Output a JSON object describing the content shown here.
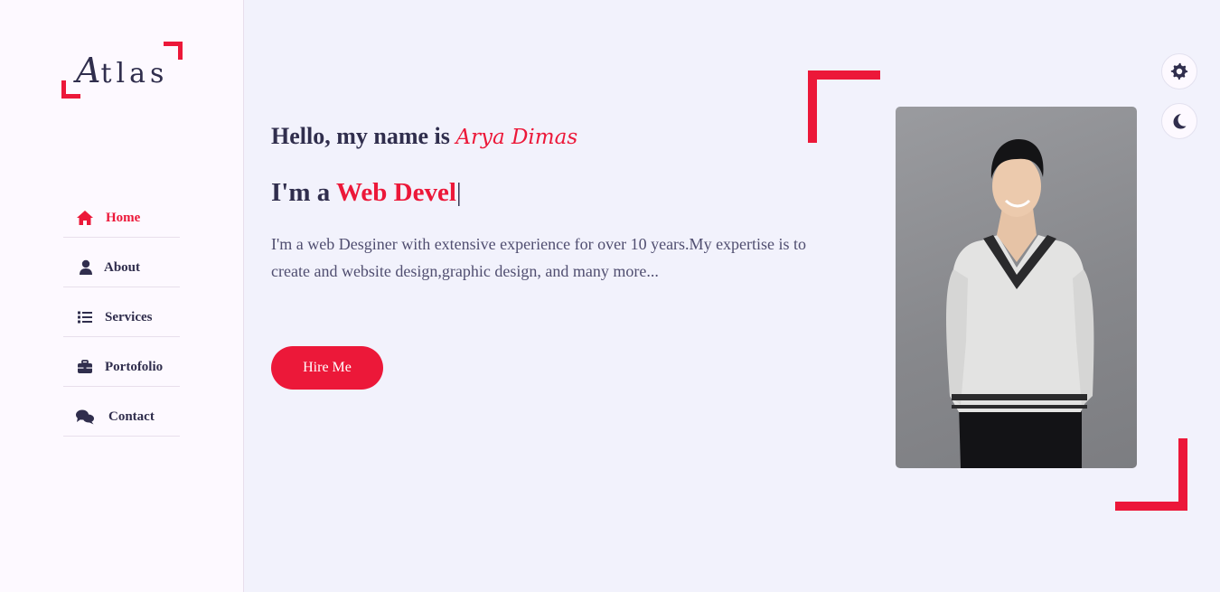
{
  "logo": {
    "first_letter": "A",
    "rest": "tlas"
  },
  "nav": {
    "items": [
      {
        "label": "Home",
        "icon": "home-icon",
        "active": true
      },
      {
        "label": "About",
        "icon": "user-icon",
        "active": false
      },
      {
        "label": "Services",
        "icon": "list-icon",
        "active": false
      },
      {
        "label": "Portofolio",
        "icon": "briefcase-icon",
        "active": false
      },
      {
        "label": "Contact",
        "icon": "comments-icon",
        "active": false
      }
    ]
  },
  "home": {
    "hello_prefix": "Hello, my name is ",
    "name": "Arya Dimas",
    "role_prefix": "I'm a ",
    "role_typed": "Web Devel",
    "cursor": "|",
    "description": "I'm a web Desginer with extensive experience for over 10 years.My expertise is to create and website design,graphic design, and many more...",
    "hire_label": "Hire Me"
  },
  "photo": {
    "icon": "profile-photo"
  },
  "toggles": {
    "settings_icon": "gear-icon",
    "night_icon": "moon-icon"
  },
  "colors": {
    "accent": "#ec1839",
    "text": "#302e4d",
    "background": "#f2f2fc",
    "sidebar": "#fdf9ff"
  }
}
